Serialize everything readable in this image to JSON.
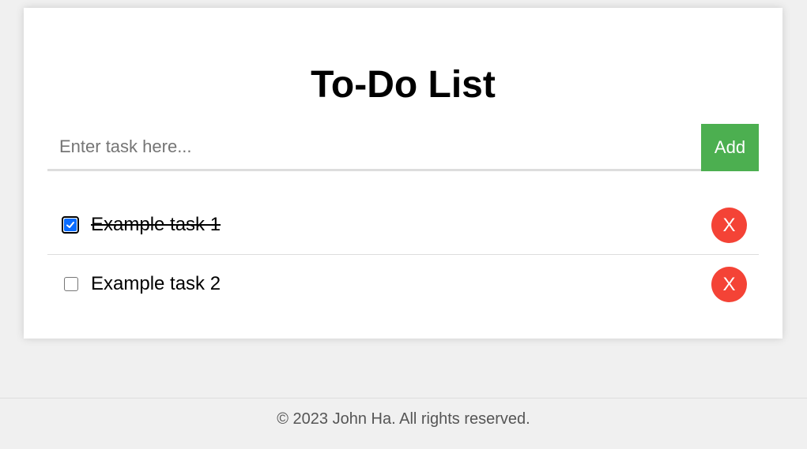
{
  "app": {
    "title": "To-Do List"
  },
  "input": {
    "placeholder": "Enter task here...",
    "value": ""
  },
  "add_button": {
    "label": "Add"
  },
  "tasks": [
    {
      "label": "Example task 1",
      "completed": true,
      "delete_label": "X"
    },
    {
      "label": "Example task 2",
      "completed": false,
      "delete_label": "X"
    }
  ],
  "footer": {
    "text": "© 2023 John Ha. All rights reserved."
  },
  "colors": {
    "background": "#f0f0f0",
    "card": "#ffffff",
    "add_button": "#4caf50",
    "delete_button": "#f44336",
    "checkbox_checked": "#0a6cff"
  }
}
